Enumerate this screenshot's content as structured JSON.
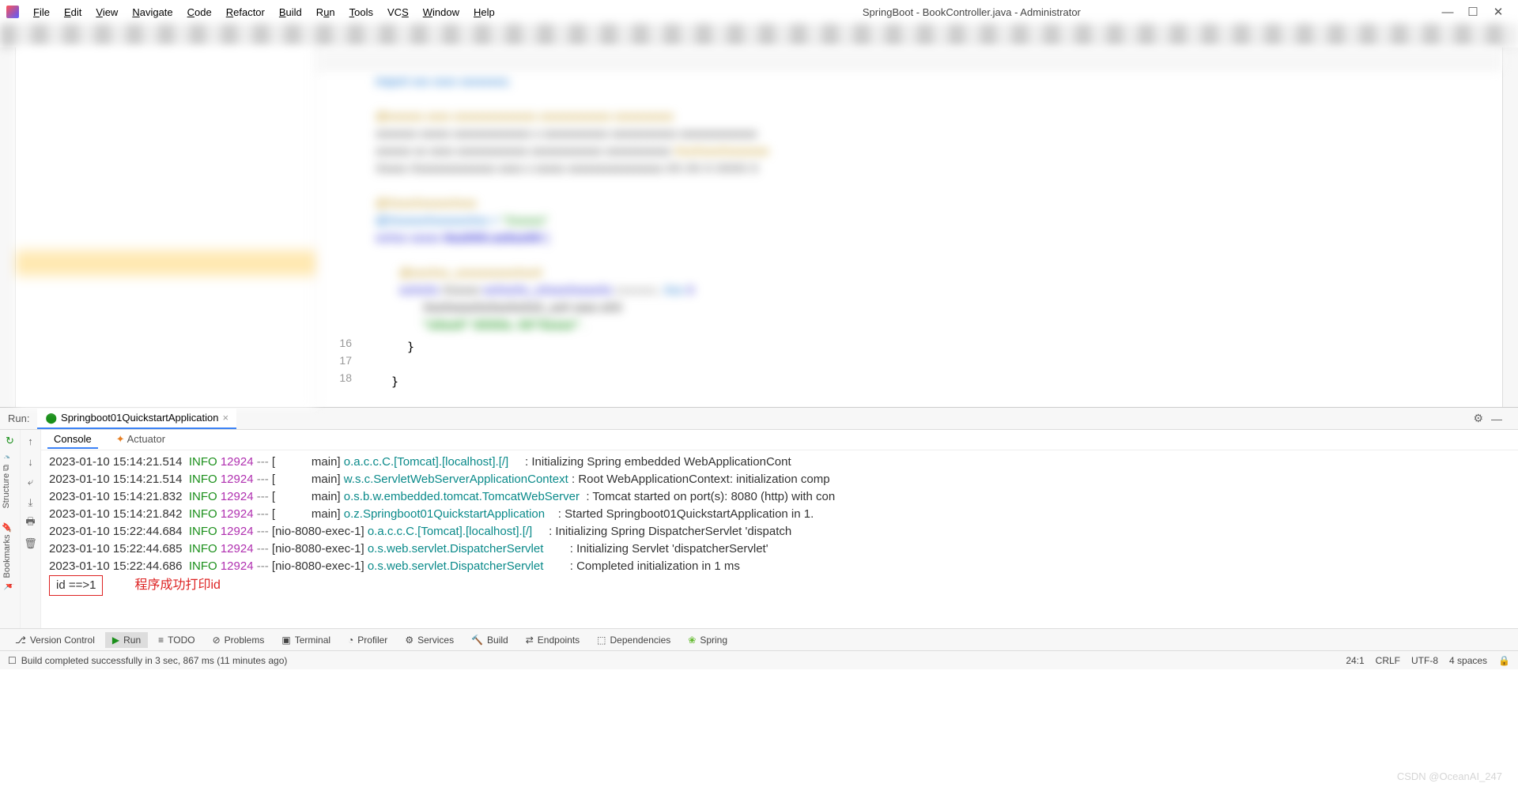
{
  "title": "SpringBoot - BookController.java - Administrator",
  "menu": [
    "File",
    "Edit",
    "View",
    "Navigate",
    "Code",
    "Refactor",
    "Build",
    "Run",
    "Tools",
    "VCS",
    "Window",
    "Help"
  ],
  "gutter_lines": [
    "",
    "",
    "",
    "",
    "",
    "",
    "",
    "",
    "",
    "",
    "",
    "",
    "",
    "",
    "",
    "16",
    "17",
    "18"
  ],
  "code_visible": {
    "l16": "}",
    "l18": "}"
  },
  "run": {
    "label": "Run:",
    "tab": "Springboot01QuickstartApplication",
    "console_tab": "Console",
    "actuator_tab": "Actuator"
  },
  "logs": [
    {
      "ts": "2023-01-10 15:14:21.514",
      "level": "INFO",
      "pid": "12924",
      "dash": "---",
      "thread": "[           main]",
      "logger": "o.a.c.c.C.[Tomcat].[localhost].[/]",
      "sep": "     : ",
      "msg": "Initializing Spring embedded WebApplicationCont"
    },
    {
      "ts": "2023-01-10 15:14:21.514",
      "level": "INFO",
      "pid": "12924",
      "dash": "---",
      "thread": "[           main]",
      "logger": "w.s.c.ServletWebServerApplicationContext",
      "sep": " : ",
      "msg": "Root WebApplicationContext: initialization comp"
    },
    {
      "ts": "2023-01-10 15:14:21.832",
      "level": "INFO",
      "pid": "12924",
      "dash": "---",
      "thread": "[           main]",
      "logger": "o.s.b.w.embedded.tomcat.TomcatWebServer",
      "sep": "  : ",
      "msg": "Tomcat started on port(s): 8080 (http) with con"
    },
    {
      "ts": "2023-01-10 15:14:21.842",
      "level": "INFO",
      "pid": "12924",
      "dash": "---",
      "thread": "[           main]",
      "logger": "o.z.Springboot01QuickstartApplication",
      "sep": "    : ",
      "msg": "Started Springboot01QuickstartApplication in 1."
    },
    {
      "ts": "2023-01-10 15:22:44.684",
      "level": "INFO",
      "pid": "12924",
      "dash": "---",
      "thread": "[nio-8080-exec-1]",
      "logger": "o.a.c.c.C.[Tomcat].[localhost].[/]",
      "sep": "     : ",
      "msg": "Initializing Spring DispatcherServlet 'dispatch"
    },
    {
      "ts": "2023-01-10 15:22:44.685",
      "level": "INFO",
      "pid": "12924",
      "dash": "---",
      "thread": "[nio-8080-exec-1]",
      "logger": "o.s.web.servlet.DispatcherServlet",
      "sep": "        : ",
      "msg": "Initializing Servlet 'dispatcherServlet'"
    },
    {
      "ts": "2023-01-10 15:22:44.686",
      "level": "INFO",
      "pid": "12924",
      "dash": "---",
      "thread": "[nio-8080-exec-1]",
      "logger": "o.s.web.servlet.DispatcherServlet",
      "sep": "        : ",
      "msg": "Completed initialization in 1 ms"
    }
  ],
  "id_output": "id ==>1",
  "id_note": "程序成功打印id",
  "bottom_tools": [
    "Version Control",
    "Run",
    "TODO",
    "Problems",
    "Terminal",
    "Profiler",
    "Services",
    "Build",
    "Endpoints",
    "Dependencies",
    "Spring"
  ],
  "status": {
    "msg": "Build completed successfully in 3 sec, 867 ms (11 minutes ago)",
    "pos": "24:1",
    "eol": "CRLF",
    "enc": "UTF-8",
    "indent": "4 spaces"
  },
  "watermark": "CSDN @OceanAI_247"
}
